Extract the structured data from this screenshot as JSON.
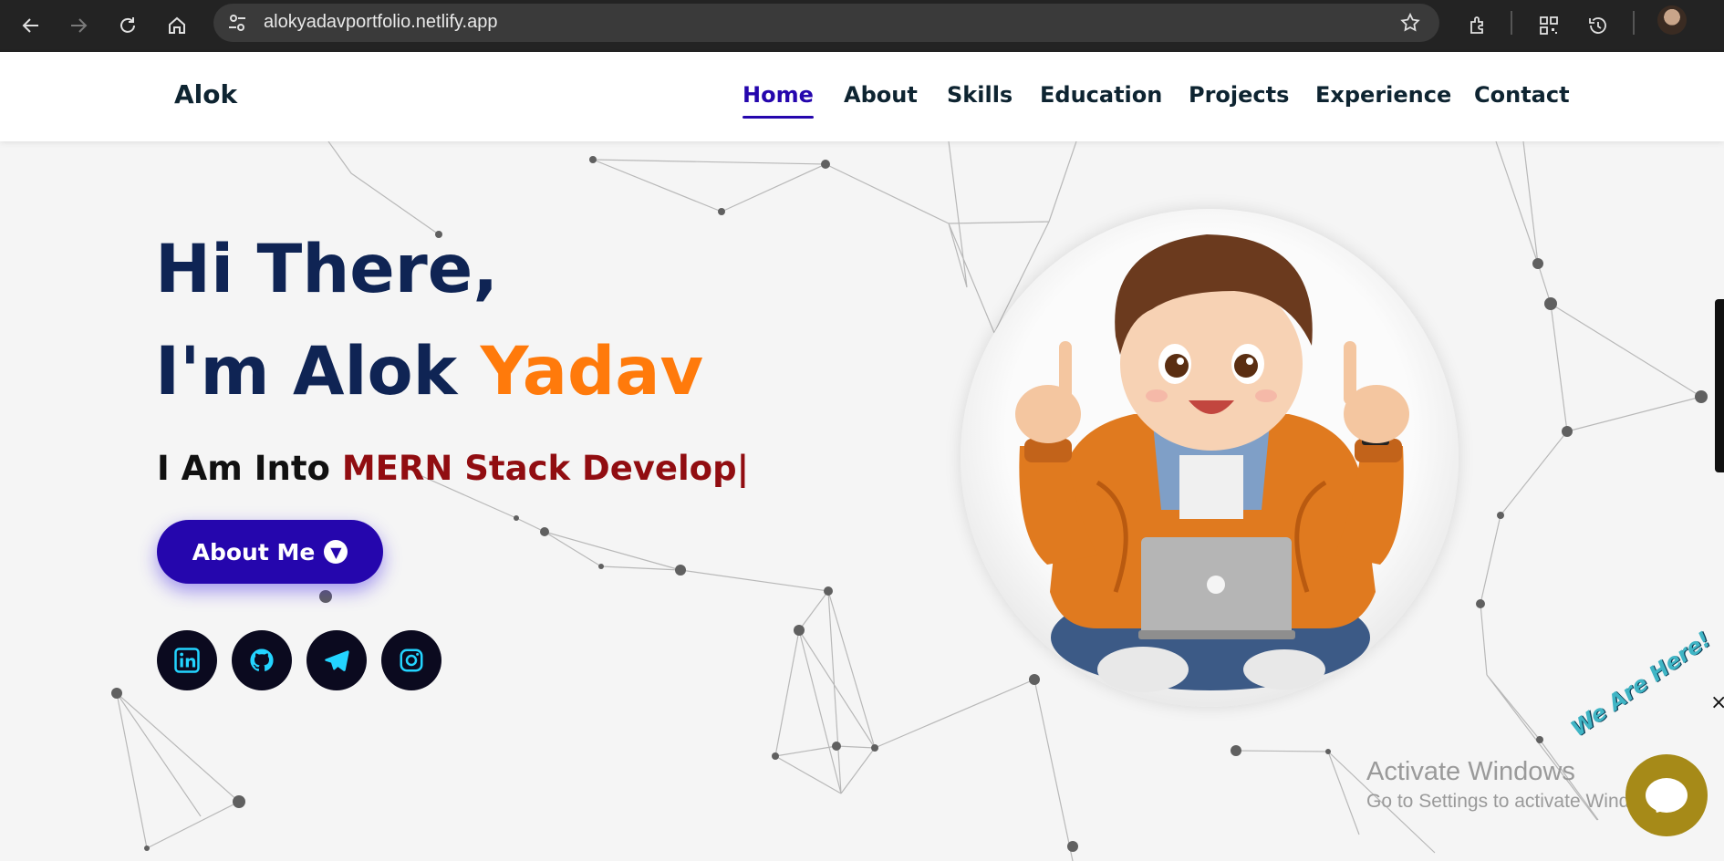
{
  "browser": {
    "url": "alokyadavportfolio.netlify.app"
  },
  "site": {
    "logo": "Alok",
    "nav": [
      "Home",
      "About",
      "Skills",
      "Education",
      "Projects",
      "Experience",
      "Contact"
    ],
    "active_nav": "Home"
  },
  "hero": {
    "line1": "Hi There,",
    "line2_prefix": "I'm Alok ",
    "line2_accent": "Yadav",
    "typed_prefix": "I Am Into ",
    "typed_text": "MERN Stack Develop|",
    "button_label": "About Me",
    "social": [
      "linkedin-icon",
      "github-icon",
      "telegram-icon",
      "instagram-icon"
    ]
  },
  "overlay": {
    "watermark_title": "Activate Windows",
    "watermark_sub": "Go to Settings to activate Windows.",
    "chat_badge": "We Are Here!",
    "close": "×"
  },
  "colors": {
    "primary": "#2506ad",
    "accent": "#ff7a0b",
    "heading": "#0f2454",
    "typed": "#910d11"
  }
}
